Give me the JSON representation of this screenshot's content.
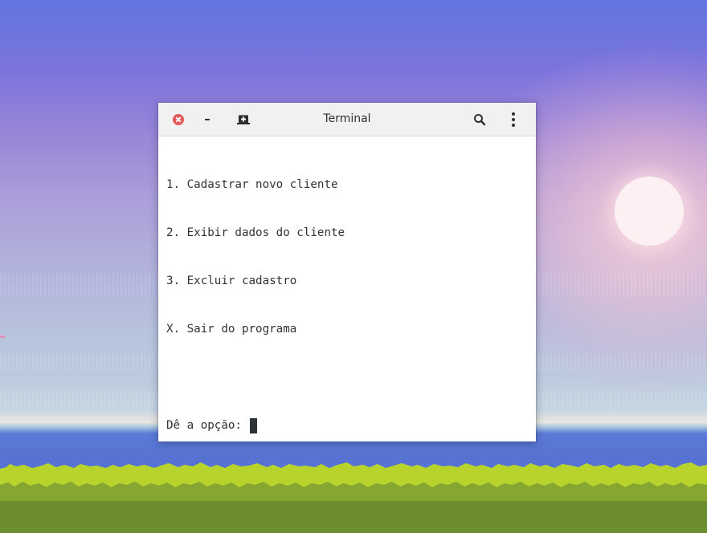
{
  "window": {
    "title": "Terminal",
    "buttons": {
      "close_icon": "close-icon",
      "minimize_label": "-",
      "new_tab_icon": "new-tab-icon",
      "search_icon": "search-icon",
      "menu_icon": "more-vertical-icon"
    }
  },
  "terminal": {
    "lines": [
      "1. Cadastrar novo cliente",
      "2. Exibir dados do cliente",
      "3. Excluir cadastro",
      "X. Sair do programa",
      ""
    ],
    "prompt": "Dê a opção:"
  },
  "colors": {
    "close_button": "#e35b5b",
    "terminal_text": "#2e3436",
    "titlebar_bg": "#f1f1f1"
  }
}
